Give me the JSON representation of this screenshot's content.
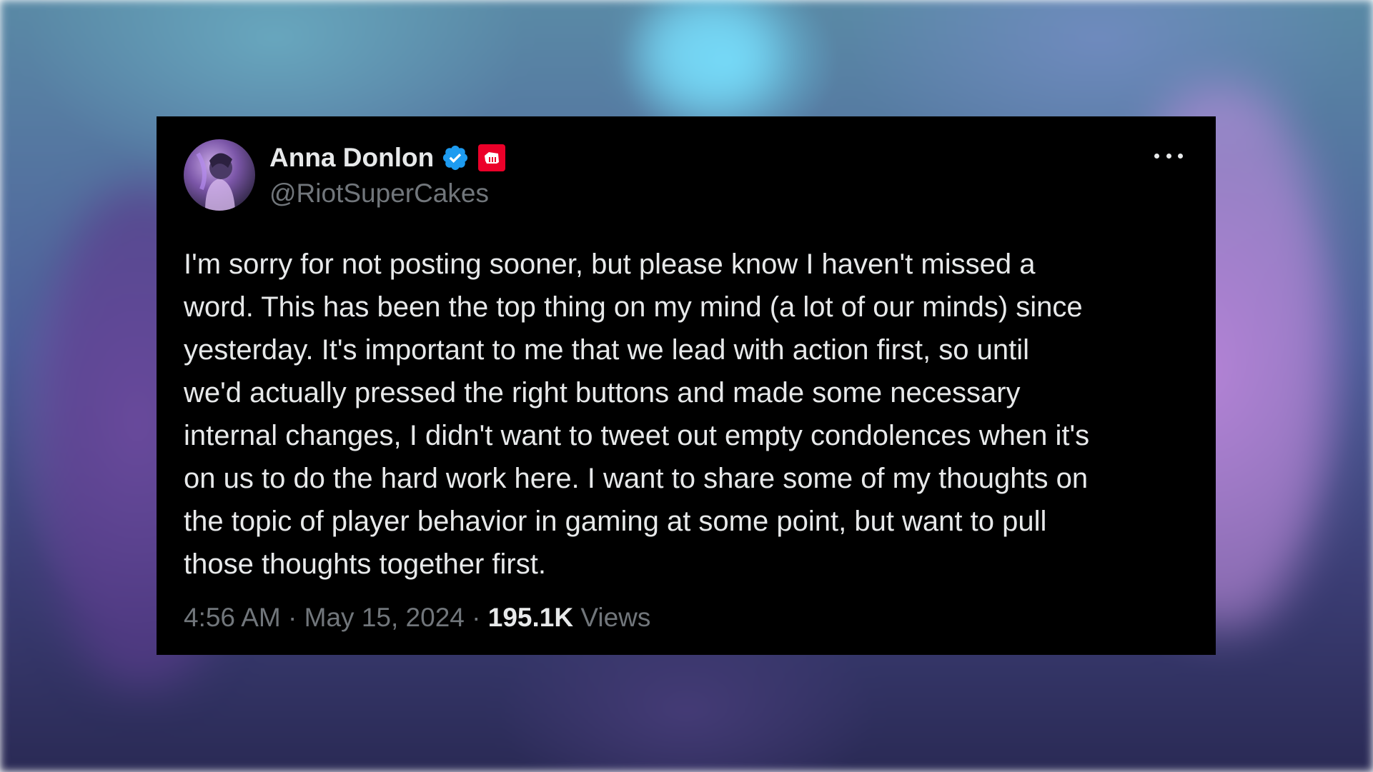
{
  "author": {
    "display_name": "Anna Donlon",
    "handle": "@RiotSuperCakes",
    "verified": true,
    "affiliate_badge": "riot-fist-icon",
    "avatar": "profile-avatar"
  },
  "tweet": {
    "text": "I'm sorry for not posting sooner, but please know I haven't missed a\nword. This has been the top thing on my mind (a lot of our minds) since\nyesterday. It's important to me that we lead with action first, so until\nwe'd actually pressed the right buttons and made some necessary\ninternal changes, I didn't want to tweet out empty condolences when it's\non us to do the hard work here. I want to share some of my thoughts on\nthe topic of player behavior in gaming at some point, but want to pull\nthose thoughts together first.",
    "time": "4:56 AM",
    "separator": " · ",
    "date": "May 15, 2024",
    "views_count": "195.1K",
    "views_label": " Views"
  },
  "colors": {
    "card_background": "#000000",
    "primary_text": "#e7e9ea",
    "secondary_text": "#71767b",
    "verified_blue": "#1d9bf0",
    "affiliate_red": "#eb0029"
  },
  "icons": {
    "more": "more-horizontal-icon",
    "verified": "verified-badge-icon"
  }
}
